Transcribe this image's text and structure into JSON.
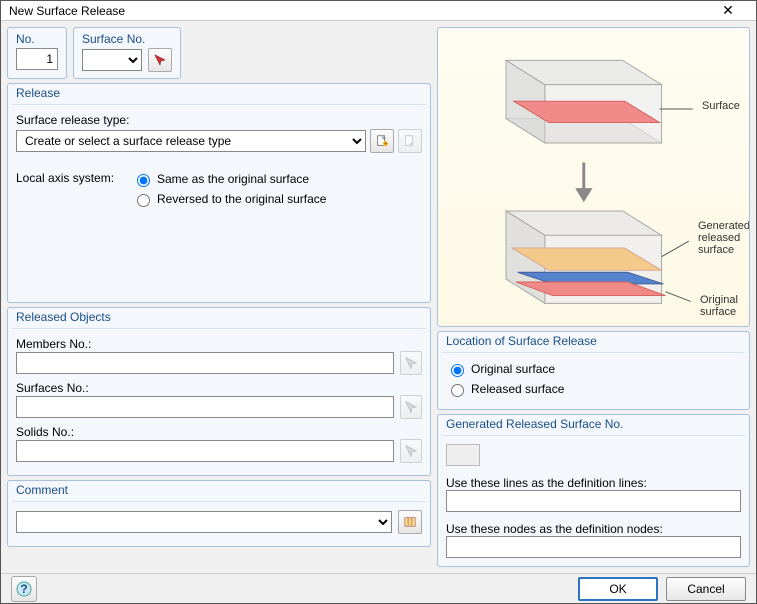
{
  "titlebar": {
    "title": "New Surface Release"
  },
  "top": {
    "no_title": "No.",
    "no_value": "1",
    "surface_no_title": "Surface No.",
    "surface_no_value": ""
  },
  "release": {
    "title": "Release",
    "type_label": "Surface release type:",
    "type_placeholder": "Create or select a surface release type",
    "axis_label": "Local axis system:",
    "axis_same": "Same as the original surface",
    "axis_reversed": "Reversed to the original surface"
  },
  "released_objects": {
    "title": "Released Objects",
    "members_label": "Members No.:",
    "surfaces_label": "Surfaces No.:",
    "solids_label": "Solids No.:"
  },
  "comment": {
    "title": "Comment"
  },
  "preview": {
    "label_surface": "Surface",
    "label_generated": "Generated released surface",
    "label_original": "Original surface"
  },
  "location": {
    "title": "Location of Surface Release",
    "opt_original": "Original surface",
    "opt_released": "Released surface"
  },
  "generated": {
    "title": "Generated Released Surface No.",
    "lines_label": "Use these lines as the definition lines:",
    "nodes_label": "Use these nodes as the definition nodes:"
  },
  "footer": {
    "ok": "OK",
    "cancel": "Cancel"
  },
  "icons": {
    "pick": "pick-icon",
    "new": "new-doc-icon",
    "edit": "edit-icon",
    "library": "library-icon",
    "help": "help-icon",
    "close": "close-icon"
  }
}
